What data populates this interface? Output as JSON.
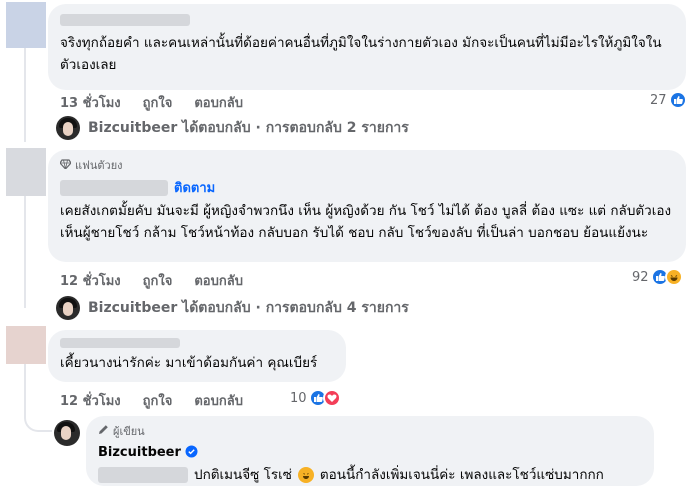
{
  "comments": [
    {
      "text": "จริงทุกถ้อยคำ และคนเหล่านั้นที่ด้อยค่าคนอื่นที่ภูมิใจในร่างกายตัวเอง มักจะเป็นคนที่ไม่มีอะไรให้ภูมิใจในตัวเองเลย",
      "time": "13 ชั่วโมง",
      "like_label": "ถูกใจ",
      "reply_label": "ตอบกลับ",
      "reaction_count": "27",
      "replies_summary": "Bizcuitbeer ได้ตอบกลับ · การตอบกลับ 2 รายการ"
    },
    {
      "badge": "แฟนตัวยง",
      "follow_label": "ติดตาม",
      "text": "เคยสังเกตมั้ยคับ มันจะมี ผู้หญิงจำพวกนึง เห็น ผู้หญิงด้วย กัน โชว์ ไม่ได้ ต้อง บูลลี่ ต้อง แซะ แต่ กลับตัวเอง เห็นผู้ชายโชว์ กล้าม โชว์หน้าท้อง กลับบอก รับได้ ชอบ กลับ โชว์ของลับ ที่เป็นล่า บอกชอบ ย้อนแย้งนะ",
      "time": "12 ชั่วโมง",
      "like_label": "ถูกใจ",
      "reply_label": "ตอบกลับ",
      "reaction_count": "92",
      "replies_summary": "Bizcuitbeer ได้ตอบกลับ · การตอบกลับ 4 รายการ"
    },
    {
      "text": "เคี้ยวนางน่ารักค่ะ มาเข้าด้อมกันค่า คุณเบียร์",
      "time": "12 ชั่วโมง",
      "like_label": "ถูกใจ",
      "reply_label": "ตอบกลับ",
      "reaction_count": "10"
    },
    {
      "badge": "ผู้เขียน",
      "author": "Bizcuitbeer",
      "text_a": "ปกติเมนจีซู โรเซ่",
      "text_b": "ตอนนี้กำลังเพิ่มเจนนี่ค่ะ เพลงและโชว์แซ่บมากกก"
    }
  ],
  "icons": {
    "like": "thumbs-up-icon",
    "love": "heart-icon",
    "haha": "laughing-face-icon",
    "fan": "diamond-icon",
    "author": "pencil-icon",
    "verified": "verified-check-icon"
  },
  "colors": {
    "bubble": "#f0f2f5",
    "meta": "#65676b",
    "accent": "#0866ff",
    "like": "#1b74e4",
    "love": "#f33e58",
    "haha": "#f7b125"
  }
}
